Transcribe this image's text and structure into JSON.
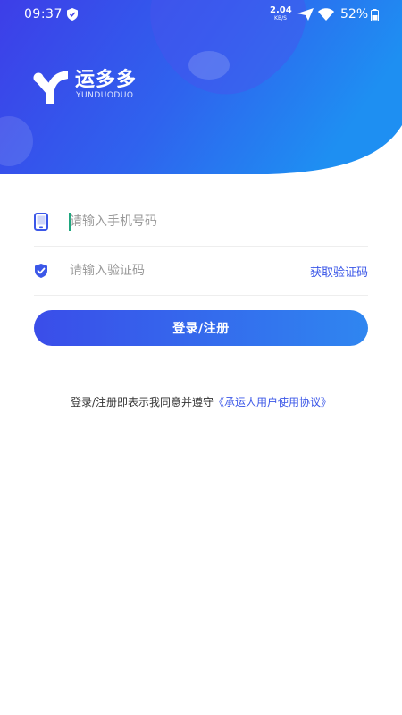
{
  "status_bar": {
    "time": "09:37",
    "net_speed_value": "2.04",
    "net_speed_unit": "KB/S",
    "battery_percent": "52%"
  },
  "brand": {
    "name": "运多多",
    "name_latin": "YUNDUODUO"
  },
  "form": {
    "phone_placeholder": "请输入手机号码",
    "code_placeholder": "请输入验证码",
    "get_code_label": "获取验证码",
    "submit_label": "登录/注册"
  },
  "agreement": {
    "text": "登录/注册即表示我同意并遵守",
    "link_text": "《承运人用户使用协议》"
  },
  "colors": {
    "accent": "#3b57e8",
    "header_gradient_start": "#3d3ee8",
    "header_gradient_end": "#1e8ff2",
    "button_gradient_start": "#3a4de9",
    "button_gradient_end": "#2f86f0",
    "caret": "#1fa77f"
  },
  "icons": {
    "phone_field": "mobile-phone-icon",
    "code_field": "shield-check-icon",
    "status_left": "shield-icon",
    "status_right": [
      "airplane-mode-icon",
      "wifi-icon",
      "battery-icon"
    ]
  }
}
